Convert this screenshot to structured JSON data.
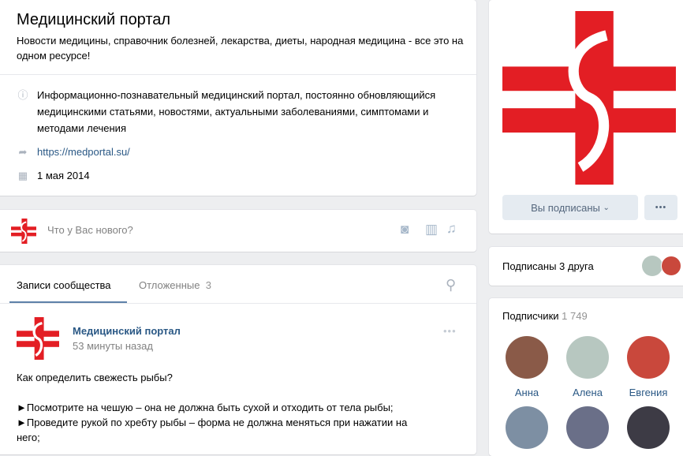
{
  "group": {
    "title": "Медицинский портал",
    "status": "Новости медицины, справочник болезней, лекарства, диеты, народная медицина - все это на одном ресурсе!",
    "description": "Информационно-познавательный медицинский портал, постоянно обновляющийся медицинскими статьями, новостями, актуальными заболеваниями, симптомами и методами лечения",
    "website": "https://medportal.su/",
    "created": "1 мая 2014"
  },
  "composer": {
    "placeholder": "Что у Вас нового?"
  },
  "tabs": {
    "posts": "Записи сообщества",
    "postponed": "Отложенные",
    "postponed_count": "3"
  },
  "post": {
    "author": "Медицинский портал",
    "time": "53 минуты назад",
    "lines": [
      "Как определить свежесть рыбы?",
      "►Посмотрите на чешую – она не должна быть сухой и отходить от тела рыбы;",
      "►Проведите рукой по хребту рыбы – форма не должна меняться при нажатии на",
      "него;"
    ]
  },
  "sidebar": {
    "subscribed_label": "Вы подписаны",
    "friends_label": "Подписаны 3 друга",
    "followers_label": "Подписчики",
    "followers_count": "1 749",
    "followers": [
      {
        "name": "Анна",
        "color": "#8a5a48"
      },
      {
        "name": "Алена",
        "color": "#b7c7c0"
      },
      {
        "name": "Евгения",
        "color": "#c9483c"
      },
      {
        "name": "",
        "color": "#7d8fa3"
      },
      {
        "name": "",
        "color": "#6a6f88"
      },
      {
        "name": "",
        "color": "#3d3b45"
      }
    ]
  },
  "colors": {
    "accent": "#2a5885",
    "brand_red": "#e31e24"
  }
}
